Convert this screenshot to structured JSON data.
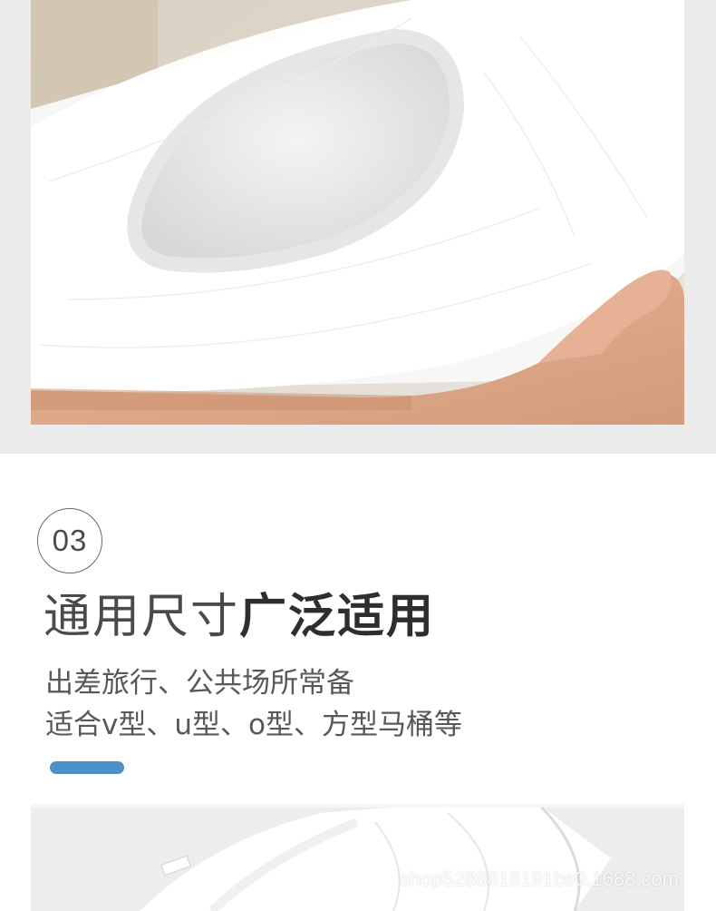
{
  "section": {
    "step_number": "03",
    "title_light": "通用尺寸",
    "title_bold": "广泛适用",
    "desc_line1": "出差旅行、公共场所常备",
    "desc_line2": "适合v型、u型、o型、方型马桶等"
  },
  "watermark": "shop5288818191bs0.1688.com",
  "colors": {
    "accent": "#4a92c7",
    "band": "#ebebeb"
  }
}
